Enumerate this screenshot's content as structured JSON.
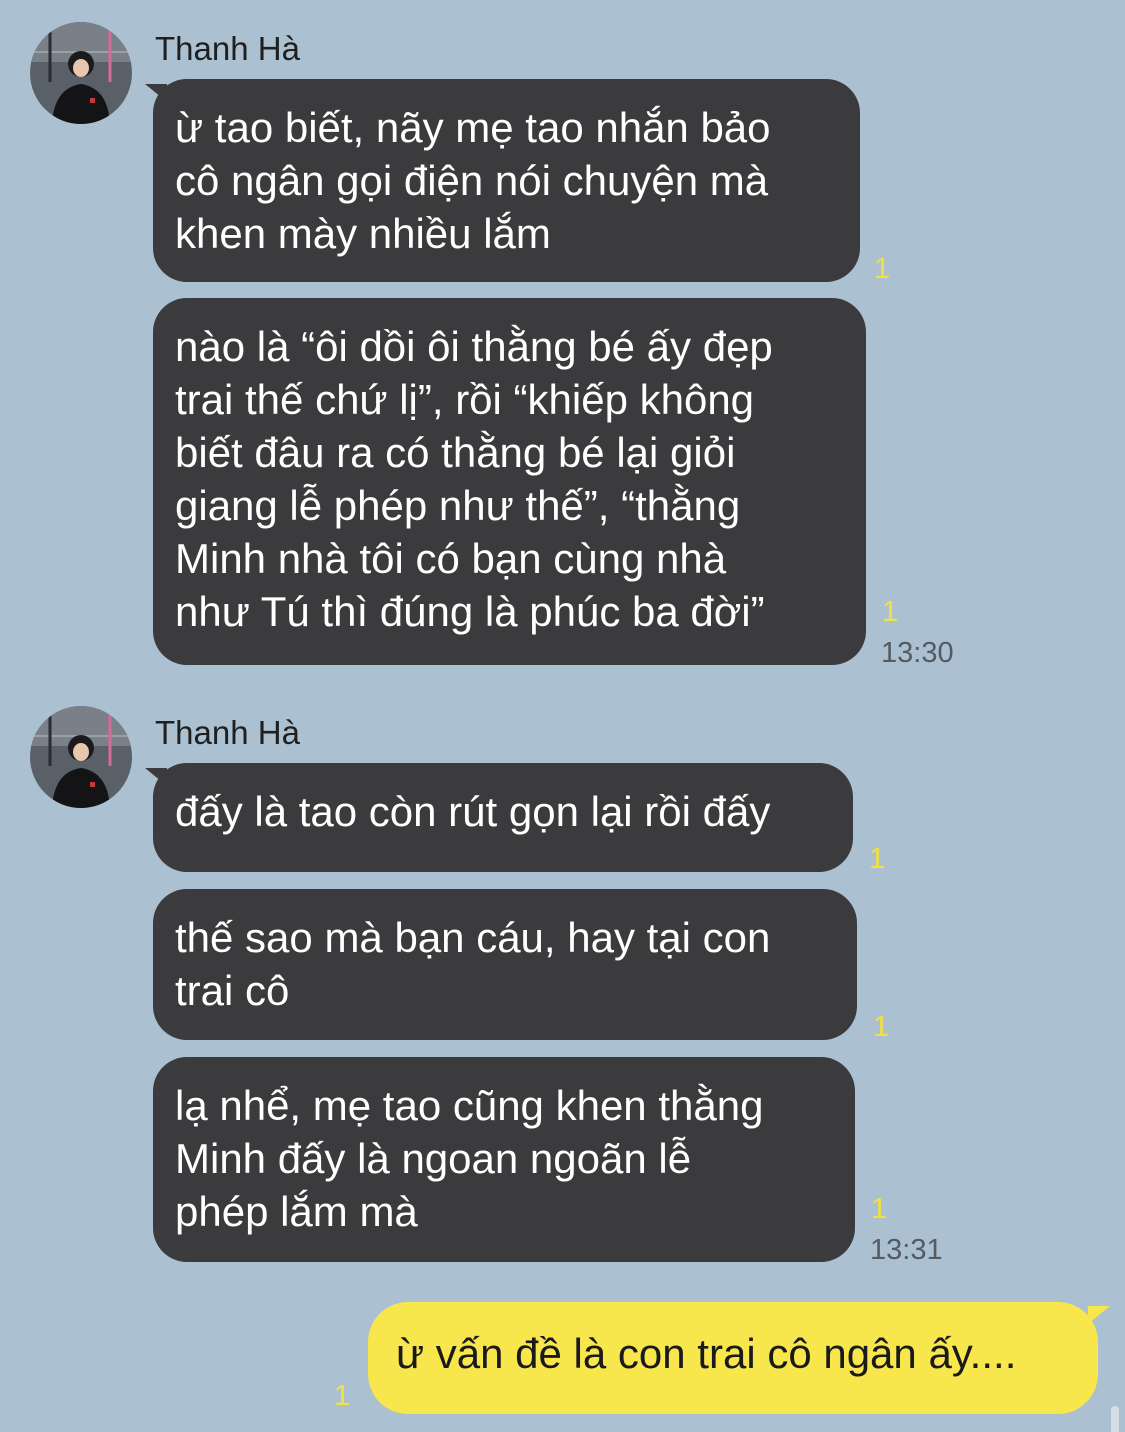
{
  "groups": [
    {
      "sender": "Thanh Hà",
      "avatar_icon": "profile-photo",
      "messages": [
        {
          "text": "ừ tao biết, nãy mẹ tao nhắn bảo\ncô ngân gọi điện nói chuyện mà\nkhen mày nhiều lắm",
          "unread": "1"
        },
        {
          "text": "nào là “ôi dồi ôi thằng bé ấy đẹp\ntrai thế chứ lị”, rồi “khiếp không\nbiết đâu ra có thằng bé lại giỏi\ngiang lễ phép như thế”, “thằng\nMinh nhà tôi có bạn cùng nhà\nnhư Tú thì đúng là phúc ba đời”",
          "unread": "1",
          "time": "13:30"
        }
      ]
    },
    {
      "sender": "Thanh Hà",
      "avatar_icon": "profile-photo",
      "messages": [
        {
          "text": "đấy là tao còn rút gọn lại rồi đấy",
          "unread": "1"
        },
        {
          "text": "thế sao mà bạn cáu, hay tại con\ntrai cô",
          "unread": "1"
        },
        {
          "text": "lạ nhể, mẹ tao cũng khen thằng\nMinh đấy là ngoan ngoãn lễ\nphép lắm mà",
          "unread": "1",
          "time": "13:31"
        }
      ]
    }
  ],
  "outgoing": {
    "text": "ừ vấn đề là con trai cô ngân ấy....",
    "unread": "1"
  },
  "colors": {
    "background": "#abc1d1",
    "incoming_bubble": "#3b3b3d",
    "outgoing_bubble": "#f7e64c",
    "unread_count": "#f4e03e",
    "timestamp": "#545b63"
  }
}
